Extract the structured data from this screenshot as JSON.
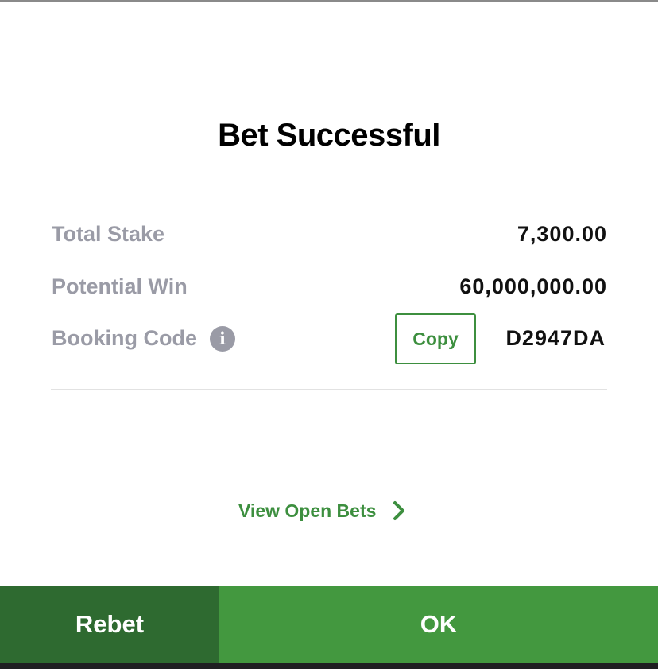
{
  "dialog": {
    "title": "Bet Successful"
  },
  "summary": {
    "total_stake_label": "Total Stake",
    "total_stake_value": "7,300.00",
    "potential_win_label": "Potential Win",
    "potential_win_value": "60,000,000.00",
    "booking_code_label": "Booking Code",
    "booking_code_value": "D2947DA",
    "copy_label": "Copy",
    "info_icon": "info-icon"
  },
  "links": {
    "view_open_bets": "View Open Bets",
    "chevron_icon": "chevron-right-icon"
  },
  "actions": {
    "rebet_label": "Rebet",
    "ok_label": "OK"
  },
  "colors": {
    "accent_green": "#3d8f3f",
    "rebet_bg": "#2e6a30",
    "ok_bg": "#43983f",
    "label_gray": "#9a9ba6"
  }
}
